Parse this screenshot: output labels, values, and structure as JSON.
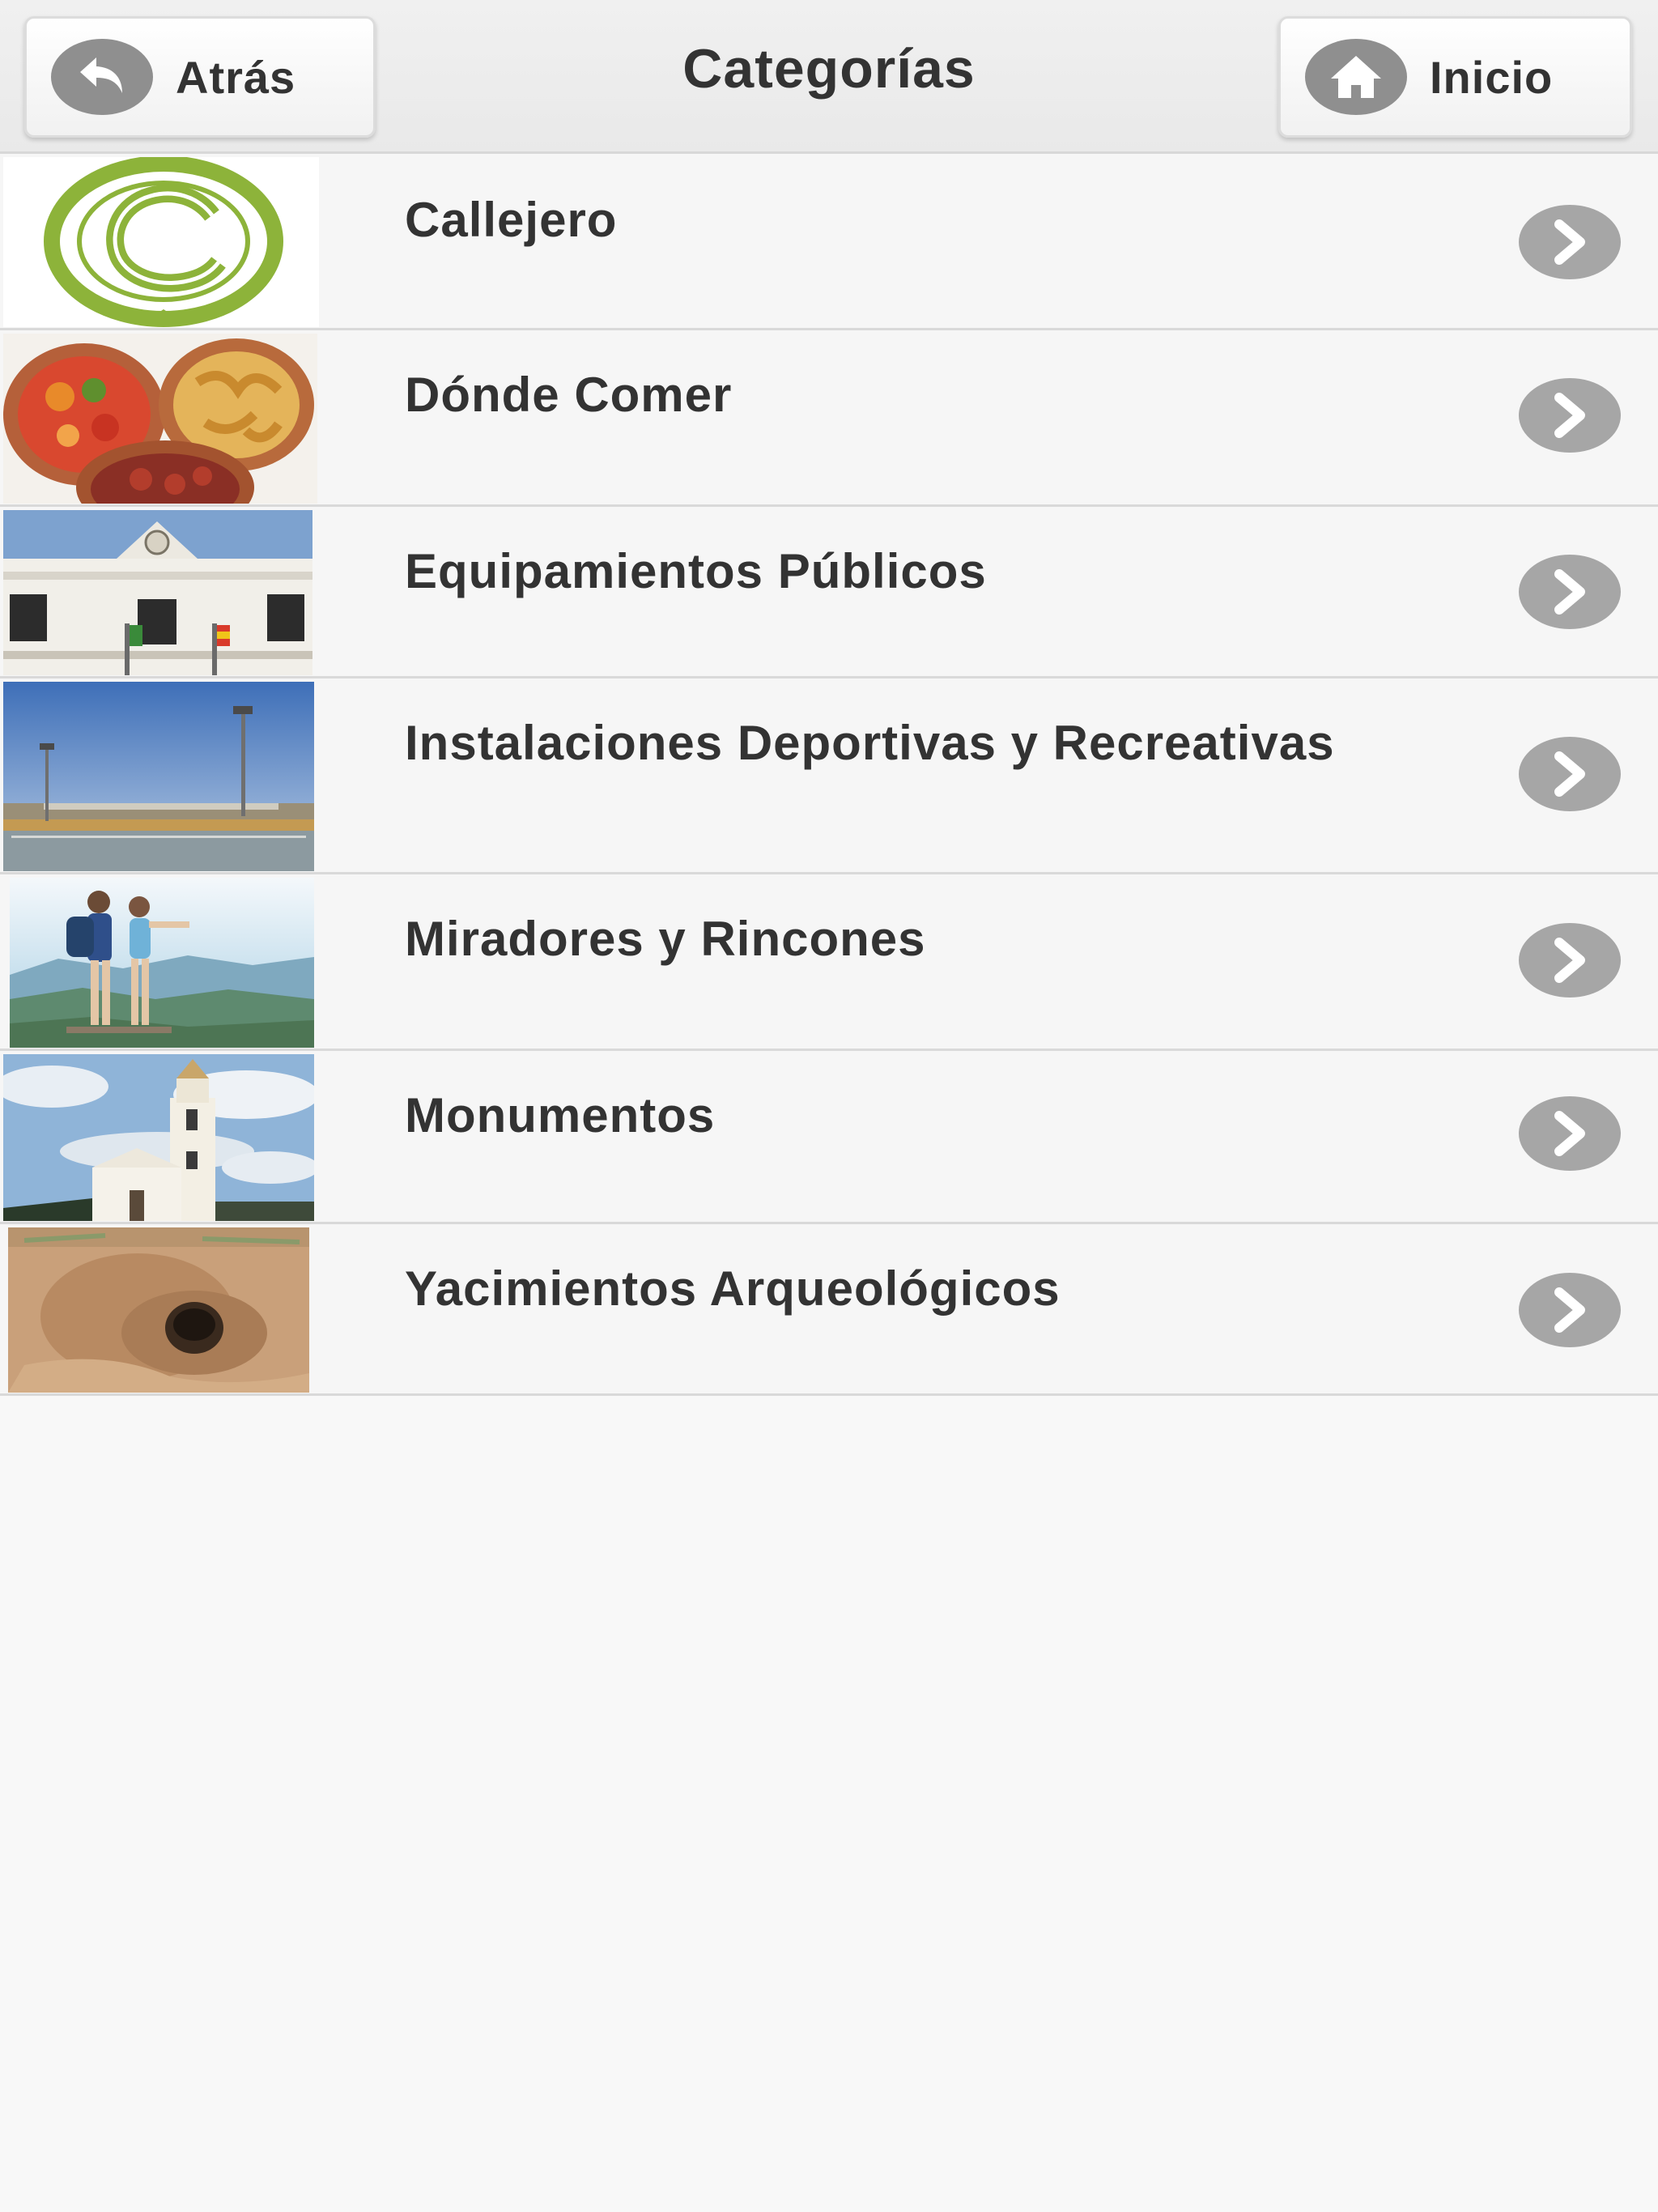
{
  "header": {
    "title": "Categorías",
    "back_label": "Atrás",
    "home_label": "Inicio"
  },
  "categories": [
    {
      "label": "Callejero",
      "thumb": "callejero-logo"
    },
    {
      "label": "Dónde Comer",
      "thumb": "tapas-food-photo"
    },
    {
      "label": "Equipamientos Públicos",
      "thumb": "town-hall-photo"
    },
    {
      "label": "Instalaciones Deportivas y Recreativas",
      "thumb": "sports-field-photo"
    },
    {
      "label": "Miradores y Rincones",
      "thumb": "hikers-viewpoint-photo"
    },
    {
      "label": "Monumentos",
      "thumb": "church-tower-photo"
    },
    {
      "label": "Yacimientos Arqueológicos",
      "thumb": "archaeological-cave-photo"
    }
  ],
  "icons": {
    "back": "back-arrow-icon",
    "home": "home-icon",
    "row_action": "chevron-right-icon"
  },
  "colors": {
    "header_bg": "#ececec",
    "list_bg": "#f6f6f6",
    "text": "#333333",
    "icon_gray": "#a6a6a6",
    "logo_green": "#8db33a"
  }
}
